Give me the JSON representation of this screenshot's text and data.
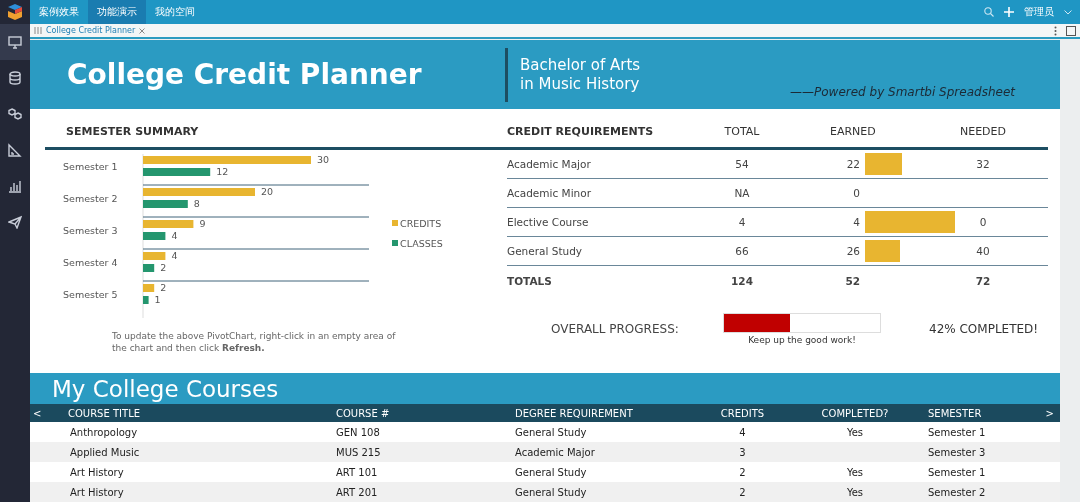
{
  "top_nav": {
    "tabs": [
      {
        "label": "案例效果",
        "selected": false
      },
      {
        "label": "功能演示",
        "selected": true
      },
      {
        "label": "我的空间",
        "selected": false
      }
    ],
    "user": "管理员"
  },
  "sidebar": {
    "items": [
      {
        "kind": "monitor",
        "selected": true
      },
      {
        "kind": "database",
        "selected": false
      },
      {
        "kind": "cubes",
        "selected": false
      },
      {
        "kind": "ruler",
        "selected": false
      },
      {
        "kind": "chart",
        "selected": false
      },
      {
        "kind": "send",
        "selected": false
      }
    ]
  },
  "doc_tabs": [
    {
      "label": "College Credit Planner",
      "selected": true
    }
  ],
  "banner": {
    "title": "College Credit Planner",
    "degree_line_1": "Bachelor of Arts",
    "degree_line_2": "in Music History",
    "powered_by": "——Powered by Smartbi Spreadsheet"
  },
  "semester_summary": {
    "heading": "SEMESTER SUMMARY",
    "chart_data": {
      "type": "bar",
      "orientation": "horizontal",
      "data_labels": true,
      "legend": "right",
      "categories": [
        "Semester 1",
        "Semester 2",
        "Semester 3",
        "Semester 4",
        "Semester 5"
      ],
      "series": [
        {
          "name": "CREDITS",
          "color": "#e8b530",
          "values": [
            30,
            20,
            9,
            4,
            2
          ]
        },
        {
          "name": "CLASSES",
          "color": "#24966e",
          "values": [
            12,
            8,
            4,
            2,
            1
          ]
        }
      ]
    },
    "note": "To update the above PivotChart, right-click in an empty area of the chart and then click **Refresh.**"
  },
  "credit_requirements": {
    "columns": [
      "CREDIT REQUIREMENTS",
      "TOTAL",
      "EARNED",
      "NEEDED"
    ],
    "rows": [
      {
        "name": "Academic Major",
        "total": "54",
        "earned": "22",
        "needed": "32",
        "level": 0.41
      },
      {
        "name": "Academic Minor",
        "total": "NA",
        "earned": "0"
      },
      {
        "name": "Elective Course",
        "total": "4",
        "earned": "4",
        "needed": "0",
        "level": 1
      },
      {
        "name": "General Study",
        "total": "66",
        "earned": "26",
        "needed": "40",
        "level": 0.39
      }
    ],
    "totals": {
      "label": "TOTALS",
      "total": "124",
      "earned": "52",
      "needed": "72"
    }
  },
  "overall_progress": {
    "label": "OVERALL PROGRESS:",
    "level": 0.42,
    "message": "Keep up the good work!",
    "reading": "42% COMPLETED!"
  },
  "courses": {
    "title": "My College Courses",
    "prev": "<",
    "next": ">",
    "columns": [
      "COURSE TITLE",
      "COURSE #",
      "DEGREE REQUIREMENT",
      "CREDITS",
      "COMPLETED?",
      "SEMESTER"
    ],
    "rows": [
      {
        "title": "Anthropology",
        "number": "GEN 108",
        "requirement": "General Study",
        "credits": "4",
        "completed": "Yes",
        "semester": "Semester 1"
      },
      {
        "title": "Applied Music",
        "number": "MUS 215",
        "requirement": "Academic Major",
        "credits": "3",
        "semester": "Semester 3"
      },
      {
        "title": "Art History",
        "number": "ART 101",
        "requirement": "General Study",
        "credits": "2",
        "completed": "Yes",
        "semester": "Semester 1"
      },
      {
        "title": "Art History",
        "number": "ART 201",
        "requirement": "General Study",
        "credits": "2",
        "completed": "Yes",
        "semester": "Semester 2"
      }
    ]
  }
}
